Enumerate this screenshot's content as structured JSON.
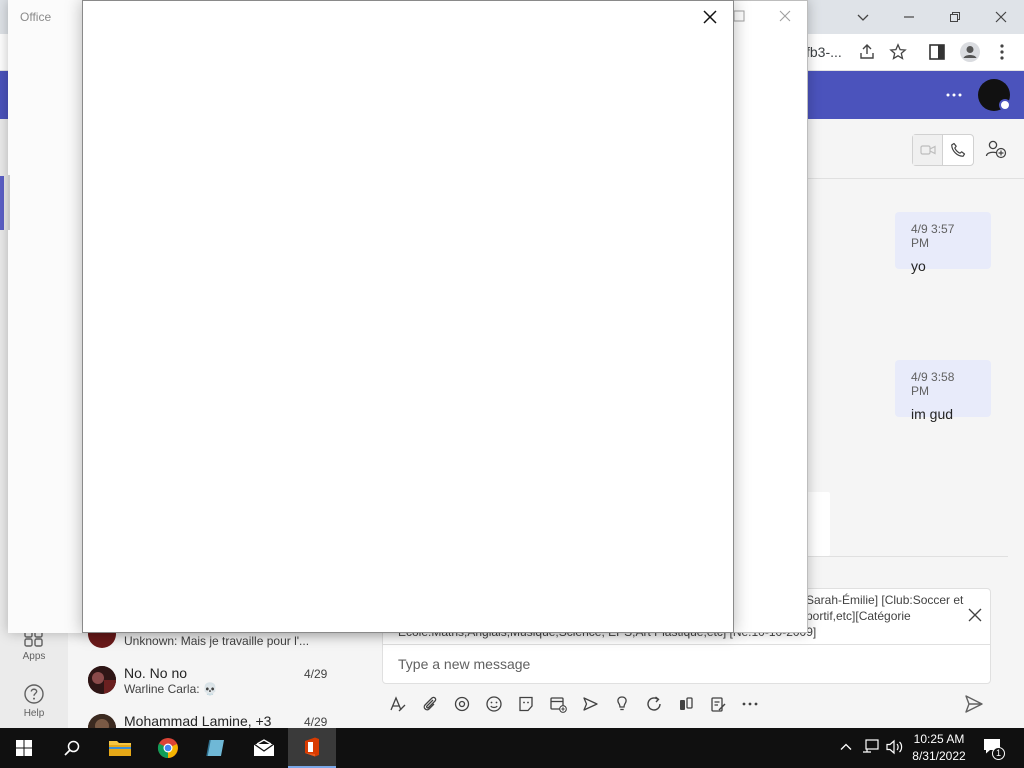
{
  "office_window": {
    "title": "Office"
  },
  "browser": {
    "url_fragment": "fb3-..."
  },
  "left_rail": {
    "apps_label": "Apps",
    "help_label": "Help"
  },
  "chat_list": {
    "items": [
      {
        "name": "",
        "preview": "Unknown: Mais je travaille pour l'...",
        "date": ""
      },
      {
        "name": "No. No no",
        "preview": "Warline Carla: 💀",
        "date": "4/29"
      },
      {
        "name": "Mohammad Lamine, +3",
        "preview": "",
        "date": "4/29"
      }
    ]
  },
  "conversation": {
    "messages": [
      {
        "time": "4/9 3:57 PM",
        "text": "yo"
      },
      {
        "time": "4/9 3:58 PM",
        "text": "im gud"
      }
    ],
    "quoted_text": {
      "line1": "Sarah-Émilie] [Club:Soccer et",
      "line2": "portif,etc][Catégorie",
      "line3": "Ecole:Maths,Anglais,Musique,Science, EPS,Art Plastique,etc] [Ne:10-10-2009]"
    },
    "compose_placeholder": "Type a new message"
  },
  "taskbar": {
    "time": "10:25 AM",
    "date": "8/31/2022",
    "notification_count": "1"
  },
  "colors": {
    "teams_header": "#4b53bc",
    "teams_accent": "#5b5fc7",
    "message_bubble": "#e8ebfa",
    "taskbar": "#101010",
    "office_orange": "#d83b01"
  }
}
